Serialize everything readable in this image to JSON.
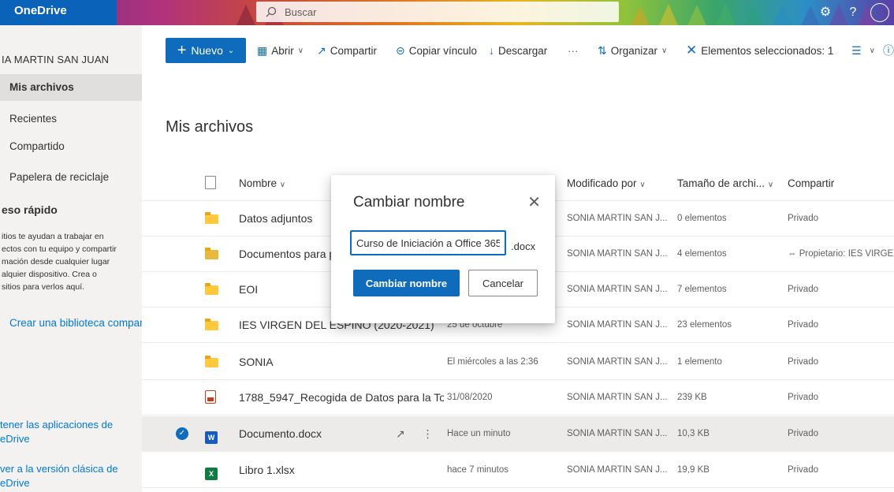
{
  "header": {
    "brand": "OneDrive",
    "search_placeholder": "Buscar"
  },
  "user": {
    "name": "IA MARTIN SAN JUAN"
  },
  "nav": {
    "items": [
      {
        "label": "Mis archivos",
        "active": true
      },
      {
        "label": "Recientes"
      },
      {
        "label": "Compartido"
      },
      {
        "label": "Papelera de reciclaje"
      }
    ],
    "quick_title": "eso rápido",
    "quick_text": [
      "itios te ayudan a trabajar en",
      "ectos con tu equipo y compartir",
      "mación desde cualquier lugar",
      "alquier dispositivo. Crea o",
      "sitios para verlos aquí."
    ],
    "create_library": "Crear una biblioteca compart",
    "get_apps": [
      "tener las aplicaciones de",
      "eDrive"
    ],
    "classic": [
      "ver a la versión clásica de",
      "eDrive"
    ]
  },
  "toolbar": {
    "new": "Nuevo",
    "open": "Abrir",
    "share": "Compartir",
    "copy_link": "Copiar vínculo",
    "download": "Descargar",
    "more": "···",
    "organize": "Organizar",
    "selected": "Elementos seleccionados: 1"
  },
  "main": {
    "title": "Mis archivos",
    "columns": {
      "name": "Nombre",
      "modified_by": "Modificado por",
      "size": "Tamaño de archi...",
      "share": "Compartir"
    },
    "rows": [
      {
        "type": "folder",
        "name": "Datos adjuntos",
        "modified": "",
        "by": "SONIA MARTIN SAN J...",
        "size": "0 elementos",
        "share": "Privado"
      },
      {
        "type": "shared-folder",
        "name": "Documentos para pr",
        "modified": "",
        "by": "SONIA MARTIN SAN J...",
        "size": "4 elementos",
        "share": "⇔ Propietario: IES VIRGEN..."
      },
      {
        "type": "folder",
        "name": "EOI",
        "modified": "",
        "by": "SONIA MARTIN SAN J...",
        "size": "7 elementos",
        "share": "Privado"
      },
      {
        "type": "folder",
        "name": "IES VIRGEN DEL ESPINO (2020-2021)",
        "modified": "25 de octubre",
        "by": "SONIA MARTIN SAN J...",
        "size": "23 elementos",
        "share": "Privado"
      },
      {
        "type": "folder",
        "name": "SONIA",
        "modified": "El miércoles a las 2:36",
        "by": "SONIA MARTIN SAN J...",
        "size": "1 elemento",
        "share": "Privado"
      },
      {
        "type": "pdf",
        "name": "1788_5947_Recogida de Datos para la Tom...",
        "modified": "31/08/2020",
        "by": "SONIA MARTIN SAN J...",
        "size": "239 KB",
        "share": "Privado"
      },
      {
        "type": "word",
        "name": "Documento.docx",
        "modified": "Hace un minuto",
        "by": "SONIA MARTIN SAN J...",
        "size": "10,3 KB",
        "share": "Privado",
        "selected": true
      },
      {
        "type": "excel",
        "name": "Libro 1.xlsx",
        "modified": "hace 7 minutos",
        "by": "SONIA MARTIN SAN J...",
        "size": "19,9 KB",
        "share": "Privado"
      }
    ]
  },
  "dialog": {
    "title": "Cambiar nombre",
    "input_value": "Curso de Iniciación a Office 365",
    "extension": ".docx",
    "confirm": "Cambiar nombre",
    "cancel": "Cancelar"
  }
}
